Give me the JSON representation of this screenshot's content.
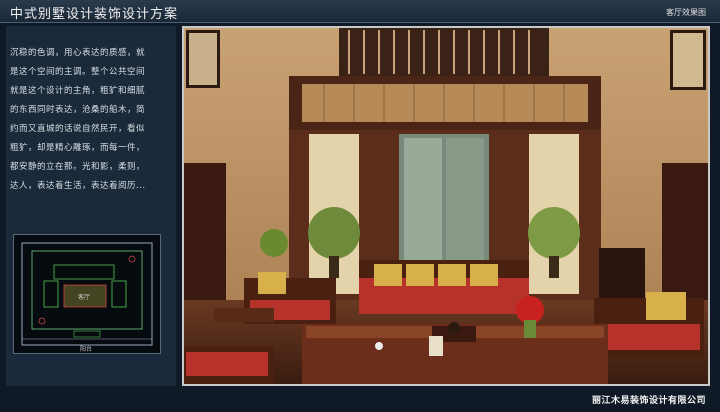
{
  "header": {
    "title": "中式别墅设计装饰设计方案",
    "subtitle": "客厅效果图"
  },
  "description": {
    "lines": [
      "沉稳的色调，用心表达的质感，就",
      "是这个空间的主调。整个公共空间",
      "就是这个设计的主角，粗犷和细腻",
      "的东西同时表达，沧桑的船木，简",
      "约而又直城的话说自然民开，看似",
      "粗犷，却是精心雕琢，而每一件，",
      "都安静的立在那。光和影，柔则，",
      "达人，表达着生活，表达着阅历..."
    ]
  },
  "floor_plan": {
    "labels": [
      "客厅",
      "阳台"
    ]
  },
  "footer": {
    "company": "丽江木易装饰设计有限公司"
  },
  "colors": {
    "header_bg": "#1f2e3f",
    "panel_bg": "#1b2a3a",
    "wood": "#5a2a18",
    "cushion_red": "#b8322c",
    "cushion_gold": "#d8b04a"
  }
}
